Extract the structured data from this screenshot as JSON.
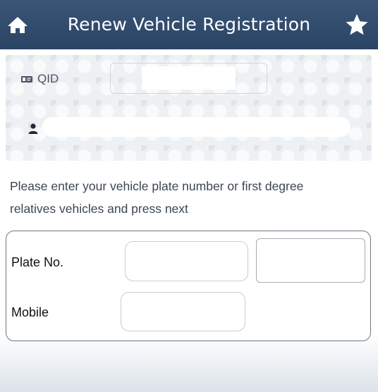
{
  "header": {
    "title": "Renew Vehicle Registration",
    "left_icon": "home-icon",
    "right_icon": "star-icon",
    "background_color": "#2f4a6b"
  },
  "identity": {
    "qid_icon": "id-card-icon",
    "qid_label": "QID",
    "qid_value": "",
    "name_icon": "user-icon",
    "name_value": ""
  },
  "instruction": {
    "line1": "Please enter your vehicle plate number or first degree",
    "line2": "relatives vehicles and press next"
  },
  "form": {
    "plate_label": "Plate No.",
    "plate_value_1": "",
    "plate_value_2": "",
    "mobile_label": "Mobile",
    "mobile_value": ""
  }
}
